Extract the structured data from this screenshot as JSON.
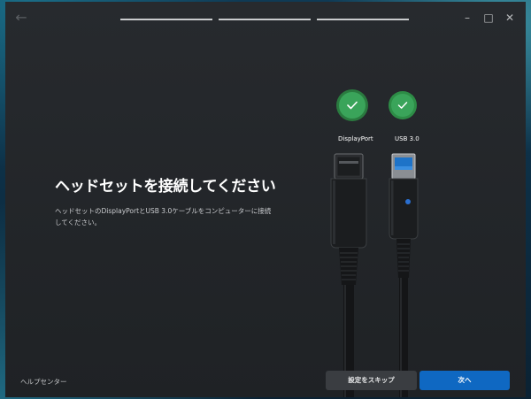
{
  "titlebar": {
    "back_icon": "arrow-left-icon",
    "progress_steps": 3,
    "controls": [
      "minimize-icon",
      "maximize-icon",
      "close-icon"
    ]
  },
  "main": {
    "heading": "ヘッドセットを接続してください",
    "description": "ヘッドセットのDisplayPortとUSB 3.0ケーブルをコンピューターに接続してください。"
  },
  "ports": [
    {
      "label": "DisplayPort",
      "status": "connected",
      "icon": "check-icon"
    },
    {
      "label": "USB 3.0",
      "status": "connected",
      "icon": "check-icon"
    }
  ],
  "footer": {
    "help_link": "ヘルプセンター",
    "skip_button": "設定をスキップ",
    "next_button": "次へ"
  },
  "colors": {
    "accent": "#0f68c2",
    "success": "#3aa45a",
    "window_bg": "#26292c"
  }
}
